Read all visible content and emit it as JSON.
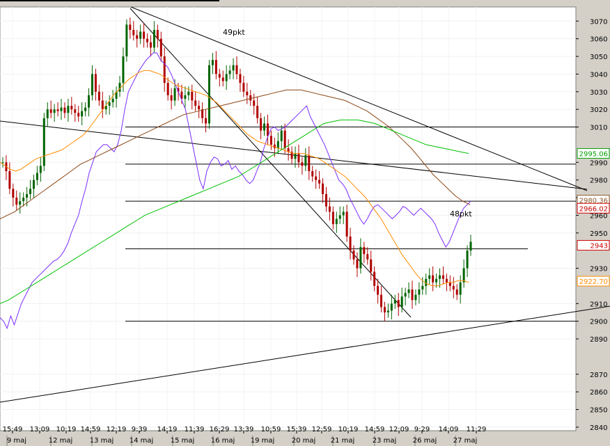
{
  "chart_data": {
    "type": "candlestick",
    "y_ticks": [
      "3070",
      "3060",
      "3050",
      "3040",
      "3030",
      "3020",
      "3010",
      "2990",
      "2980",
      "2970",
      "2960",
      "2950",
      "2930",
      "2910",
      "2900",
      "2890",
      "2870",
      "2860",
      "2850",
      "2840"
    ],
    "time_labels": [
      "15:49",
      "13:09",
      "10:19",
      "14:59",
      "12:19",
      "9:39",
      "14:19",
      "11:39",
      "16:29",
      "13:39",
      "10:59",
      "15:39",
      "12:59",
      "10:19",
      "14:59",
      "12:09",
      "9:29",
      "14:09",
      "11:29"
    ],
    "date_labels": [
      "9 maj",
      "12 maj",
      "13 maj",
      "14 maj",
      "15 maj",
      "16 maj",
      "19 maj",
      "20 maj",
      "21 maj",
      "23 maj",
      "26 maj",
      "27 maj"
    ],
    "value_badges": [
      {
        "text": "2995.06",
        "value": 2995.06,
        "color": "#00a000"
      },
      {
        "text": "2980.36",
        "value": 2968.6,
        "color": "#8b5a2b"
      },
      {
        "text": "2966.02",
        "value": 2964.0,
        "color": "#cc0000"
      },
      {
        "text": "2943",
        "value": 2943.0,
        "color": "#cc0000"
      },
      {
        "text": "2922.70",
        "value": 2922.7,
        "color": "#ff8c00"
      }
    ],
    "annotations": [
      "49pkt",
      "48pkt"
    ],
    "horizontal_levels": [
      3010,
      2989,
      2968,
      2941,
      2900
    ],
    "ylim": [
      2838,
      3078
    ],
    "series": [
      {
        "kind": "ohlc",
        "color_up": "#006400",
        "color_down": "#b00000",
        "close": [
          2990,
          2985,
          2975,
          2970,
          2966,
          2968,
          2970,
          2972,
          2975,
          2980,
          2984,
          2988,
          3015,
          3020,
          3018,
          3020,
          3019,
          3021,
          3018,
          3022,
          3020,
          3018,
          3016,
          3019,
          3021,
          3028,
          3040,
          3030,
          3025,
          3020,
          3022,
          3024,
          3026,
          3030,
          3035,
          3050,
          3068,
          3065,
          3062,
          3060,
          3064,
          3060,
          3058,
          3055,
          3065,
          3060,
          3050,
          3035,
          3028,
          3025,
          3032,
          3030,
          3026,
          3028,
          3030,
          3025,
          3022,
          3020,
          3015,
          3012,
          3045,
          3048,
          3040,
          3038,
          3036,
          3040,
          3042,
          3045,
          3040,
          3035,
          3030,
          3028,
          3025,
          3022,
          3015,
          3008,
          3012,
          3005,
          3000,
          2998,
          3002,
          3008,
          2998,
          2996,
          2992,
          2995,
          2990,
          2988,
          2994,
          2985,
          2982,
          2980,
          2978,
          2972,
          2965,
          2962,
          2955,
          2958,
          2960,
          2962,
          2948,
          2940,
          2935,
          2930,
          2942,
          2938,
          2935,
          2928,
          2920,
          2915,
          2908,
          2905,
          2906,
          2910,
          2912,
          2908,
          2914,
          2916,
          2918,
          2912,
          2915,
          2918,
          2920,
          2924,
          2926,
          2922,
          2924,
          2926,
          2924,
          2922,
          2920,
          2918,
          2915,
          2922,
          2930,
          2940,
          2945
        ]
      },
      {
        "name": "purple",
        "color": "#7b2cff",
        "values": [
          2902,
          2900,
          2896,
          2903,
          2898,
          2904,
          2910,
          2914,
          2918,
          2922,
          2924,
          2926,
          2928,
          2930,
          2932,
          2934,
          2935,
          2937,
          2940,
          2944,
          2950,
          2955,
          2960,
          2968,
          2975,
          2984,
          2990,
          2996,
          2998,
          3000,
          3000,
          2998,
          2996,
          3000,
          3008,
          3020,
          3030,
          3034,
          3038,
          3042,
          3045,
          3048,
          3050,
          3052,
          3052,
          3048,
          3046,
          3044,
          3040,
          3035,
          3030,
          3025,
          3020,
          3010,
          3000,
          2990,
          2980,
          2975,
          2985,
          2990,
          2993,
          2992,
          2988,
          2989,
          2991,
          2986,
          2988,
          2985,
          2983,
          2980,
          2978,
          2980,
          2985,
          2990,
          2998,
          3004,
          3009,
          3010,
          3008,
          3009,
          3010,
          3012,
          3014,
          3016,
          3018,
          3020,
          3022,
          3016,
          3012,
          3008,
          3004,
          3000,
          2995,
          2990,
          2985,
          2980,
          2978,
          2975,
          2970,
          2966,
          2962,
          2958,
          2955,
          2958,
          2962,
          2965,
          2966,
          2964,
          2962,
          2960,
          2958,
          2960,
          2962,
          2965,
          2964,
          2962,
          2960,
          2962,
          2964,
          2962,
          2960,
          2958,
          2955,
          2950,
          2946,
          2942,
          2945,
          2950,
          2955,
          2960,
          2964,
          2966,
          2968
        ]
      },
      {
        "name": "orange",
        "color": "#ff8c00",
        "values": [
          2990,
          2988,
          2986,
          2985,
          2986,
          2988,
          2990,
          2992,
          2993,
          2994,
          2995,
          2996,
          2997,
          2999,
          3001,
          3003,
          3005,
          3008,
          3012,
          3016,
          3020,
          3024,
          3028,
          3031,
          3034,
          3037,
          3039,
          3041,
          3042,
          3042,
          3041,
          3040,
          3038,
          3036,
          3034,
          3033,
          3032,
          3031,
          3030,
          3029,
          3028,
          3026,
          3024,
          3021,
          3018,
          3015,
          3012,
          3009,
          3006,
          3004,
          3002,
          3001,
          3000,
          2999,
          2998,
          2997,
          2996,
          2995,
          2995,
          2995,
          2994,
          2993,
          2992,
          2990,
          2988,
          2986,
          2984,
          2982,
          2979,
          2976,
          2973,
          2970,
          2966,
          2962,
          2958,
          2953,
          2948,
          2943,
          2938,
          2934,
          2930,
          2926,
          2923,
          2921,
          2920,
          2920,
          2921,
          2922,
          2922,
          2923,
          2923,
          2922
        ]
      },
      {
        "name": "brown",
        "color": "#8b4513",
        "values": [
          2958,
          2960,
          2962,
          2965,
          2968,
          2971,
          2974,
          2977,
          2980,
          2983,
          2986,
          2989,
          2991,
          2993,
          2995,
          2997,
          2999,
          3001,
          3003,
          3005,
          3007,
          3009,
          3011,
          3013,
          3015,
          3017,
          3018,
          3019,
          3020,
          3021,
          3022,
          3023,
          3024,
          3025,
          3026,
          3027,
          3028,
          3029,
          3030,
          3031,
          3031,
          3031,
          3030,
          3029,
          3028,
          3027,
          3026,
          3025,
          3023,
          3021,
          3019,
          3016,
          3013,
          3010,
          3006,
          3002,
          2998,
          2993,
          2988,
          2983,
          2979,
          2975,
          2971,
          2968,
          2966
        ]
      },
      {
        "name": "green",
        "color": "#00c000",
        "values": [
          2910,
          2912,
          2915,
          2918,
          2921,
          2924,
          2927,
          2930,
          2933,
          2936,
          2939,
          2942,
          2945,
          2948,
          2951,
          2954,
          2957,
          2960,
          2962,
          2964,
          2966,
          2968,
          2970,
          2972,
          2974,
          2976,
          2978,
          2980,
          2982,
          2985,
          2988,
          2991,
          2994,
          2997,
          3000,
          3003,
          3006,
          3009,
          3012,
          3013,
          3014,
          3014,
          3014,
          3013,
          3012,
          3010,
          3008,
          3006,
          3004,
          3002,
          3000,
          2999,
          2998,
          2997,
          2996,
          2995
        ]
      }
    ]
  }
}
